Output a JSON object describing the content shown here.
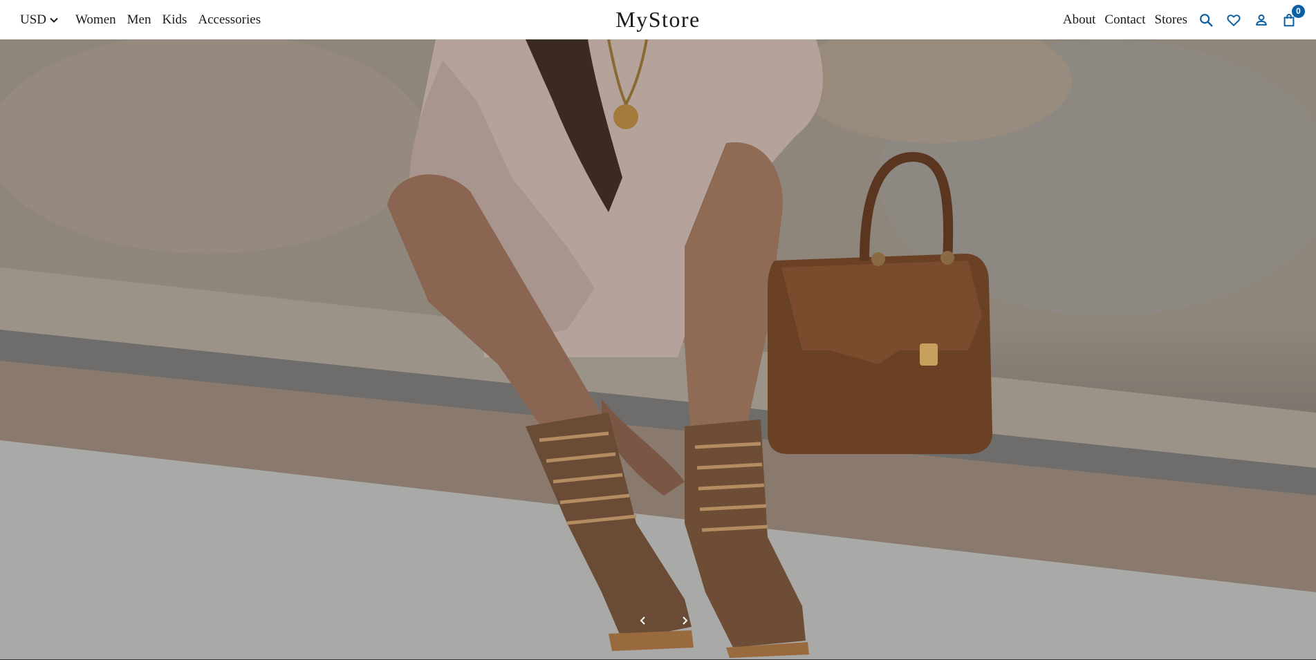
{
  "header": {
    "currency": "USD",
    "nav_left": [
      "Women",
      "Men",
      "Kids",
      "Accessories"
    ],
    "logo": "MyStore",
    "nav_right": [
      "About",
      "Contact",
      "Stores"
    ],
    "icons": [
      "search-icon",
      "heart-icon",
      "account-icon",
      "cart-icon"
    ],
    "cart_count": "0",
    "accent_color": "#0b5fa5"
  },
  "hero": {
    "image_alt": "",
    "controls": [
      "previous-slide",
      "next-slide"
    ]
  }
}
